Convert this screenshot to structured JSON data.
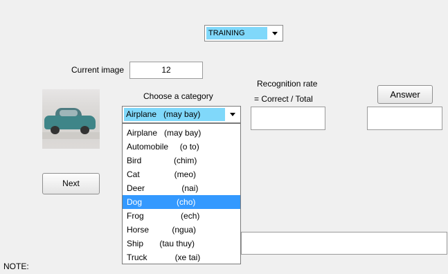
{
  "mode_select": {
    "value": "TRAINING"
  },
  "current_image": {
    "label": "Current image",
    "value": "12"
  },
  "category": {
    "label": "Choose a category",
    "selected_value": "Airplane   (may bay)",
    "options": [
      "Airplane   (may bay)",
      "Automobile     (o to)",
      "Bird              (chim)",
      "Cat               (meo)",
      "Deer                (nai)",
      "Dog               (cho)",
      "Frog                (ech)",
      "Horse          (ngua)",
      "Ship       (tau thuy)",
      "Truck            (xe tai)"
    ],
    "highlighted_index": 5
  },
  "recognition": {
    "label_line1": "Recognition rate",
    "label_line2": "= Correct / Total",
    "value": ""
  },
  "answer": {
    "button_label": "Answer",
    "value": ""
  },
  "next_button": {
    "label": "Next"
  },
  "note": {
    "label": "NOTE:",
    "value": ""
  },
  "colors": {
    "select_highlight": "#80d8fa",
    "list_selected": "#3399ff",
    "background": "#f0f0f0"
  }
}
